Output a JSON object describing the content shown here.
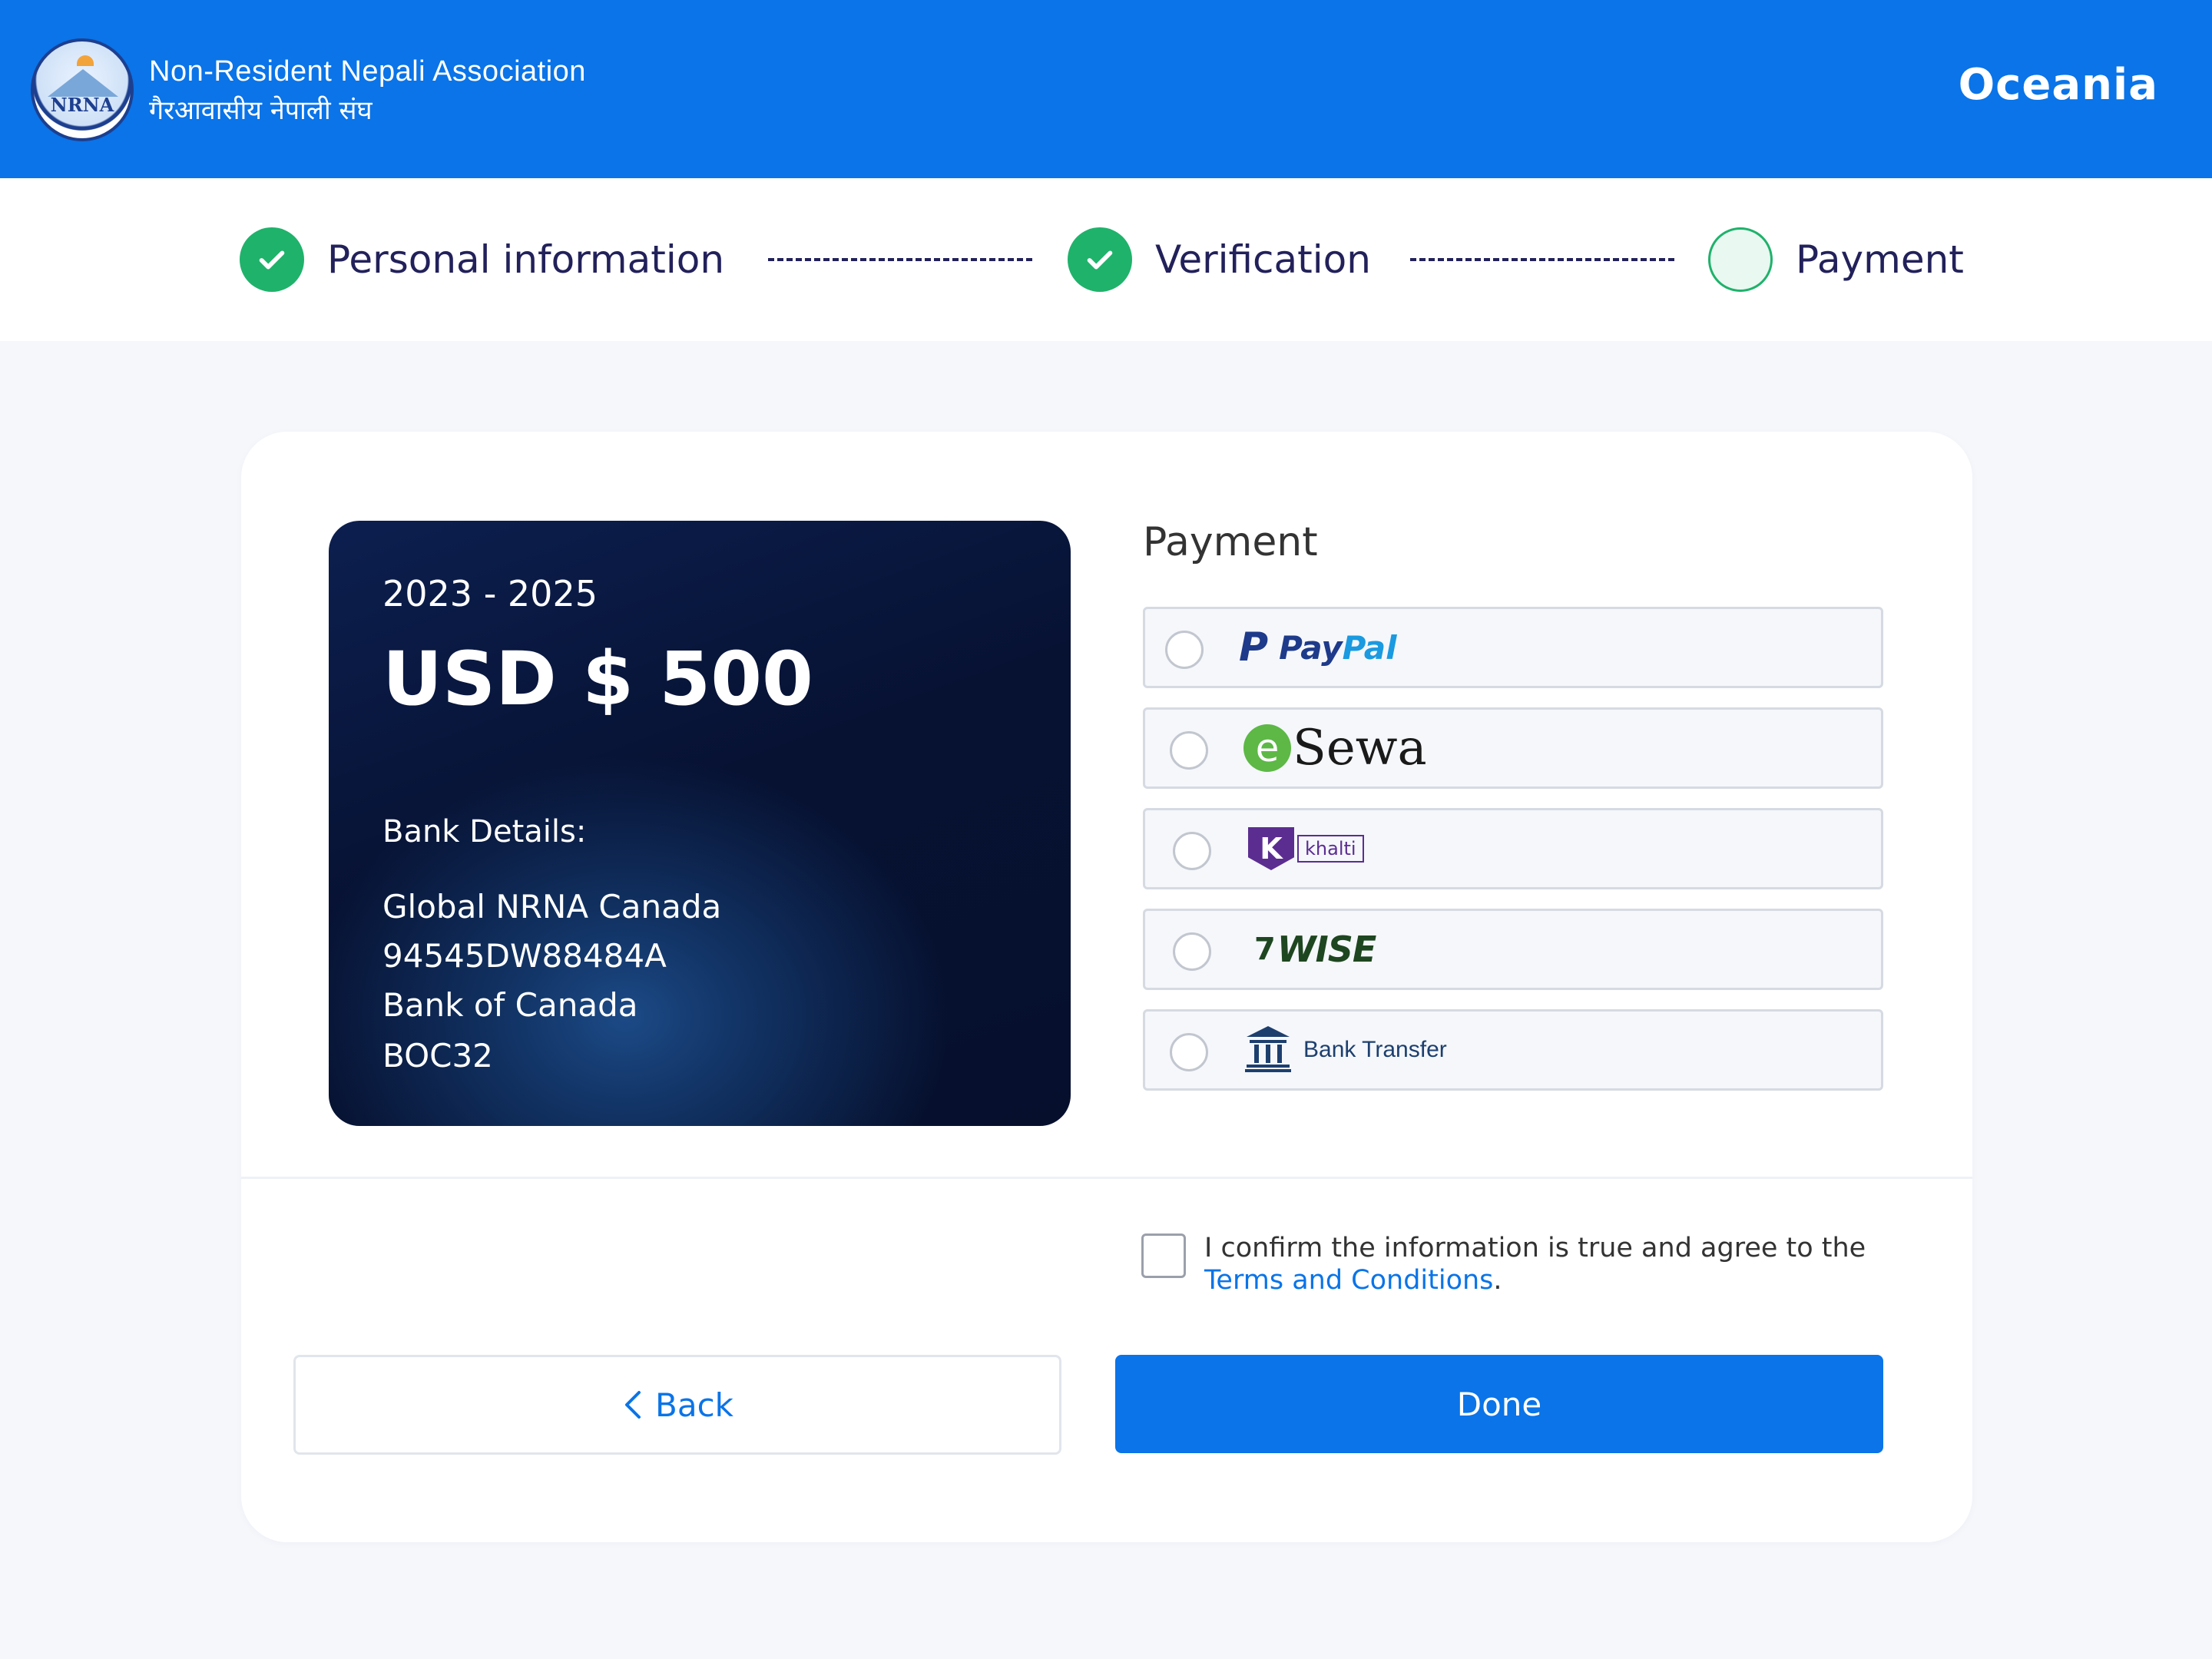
{
  "header": {
    "org_name_en": "Non-Resident Nepali Association",
    "org_name_np": "गैरआवासीय नेपाली संघ",
    "logo_text": "NRNA",
    "region": "Oceania"
  },
  "stepper": {
    "steps": [
      {
        "label": "Personal information",
        "status": "done"
      },
      {
        "label": "Verification",
        "status": "done"
      },
      {
        "label": "Payment",
        "status": "current"
      }
    ]
  },
  "fee_card": {
    "period": "2023 - 2025",
    "amount": "USD $ 500",
    "bank_title": "Bank Details:",
    "bank_lines": [
      "Global NRNA Canada",
      "94545DW88484A",
      "Bank of Canada",
      "BOC32"
    ]
  },
  "payment": {
    "title": "Payment",
    "options": [
      {
        "name": "PayPal",
        "logo_p": "P",
        "logo_a": "Pay",
        "logo_b": "Pal",
        "selected": false
      },
      {
        "name": "eSewa",
        "logo_e": "e",
        "logo_text": "Sewa",
        "selected": false
      },
      {
        "name": "Khalti",
        "logo_k": "K",
        "logo_text": "khalti",
        "selected": false
      },
      {
        "name": "Wise",
        "logo_flag": "7",
        "logo_text": "WISE",
        "selected": false
      },
      {
        "name": "Bank Transfer",
        "label": "Bank Transfer",
        "selected": false
      }
    ]
  },
  "confirm": {
    "checked": false,
    "text": "I confirm the information is true and agree to the",
    "link": "Terms and Conditions",
    "suffix": "."
  },
  "actions": {
    "back_label": "Back",
    "done_label": "Done"
  },
  "colors": {
    "brand": "#0a74e8",
    "success": "#1fb26b",
    "step_text": "#22215a",
    "card_dark": "#071233"
  },
  "icons": {
    "check": "check-icon",
    "back": "chevron-left-icon",
    "bank": "bank-icon"
  }
}
